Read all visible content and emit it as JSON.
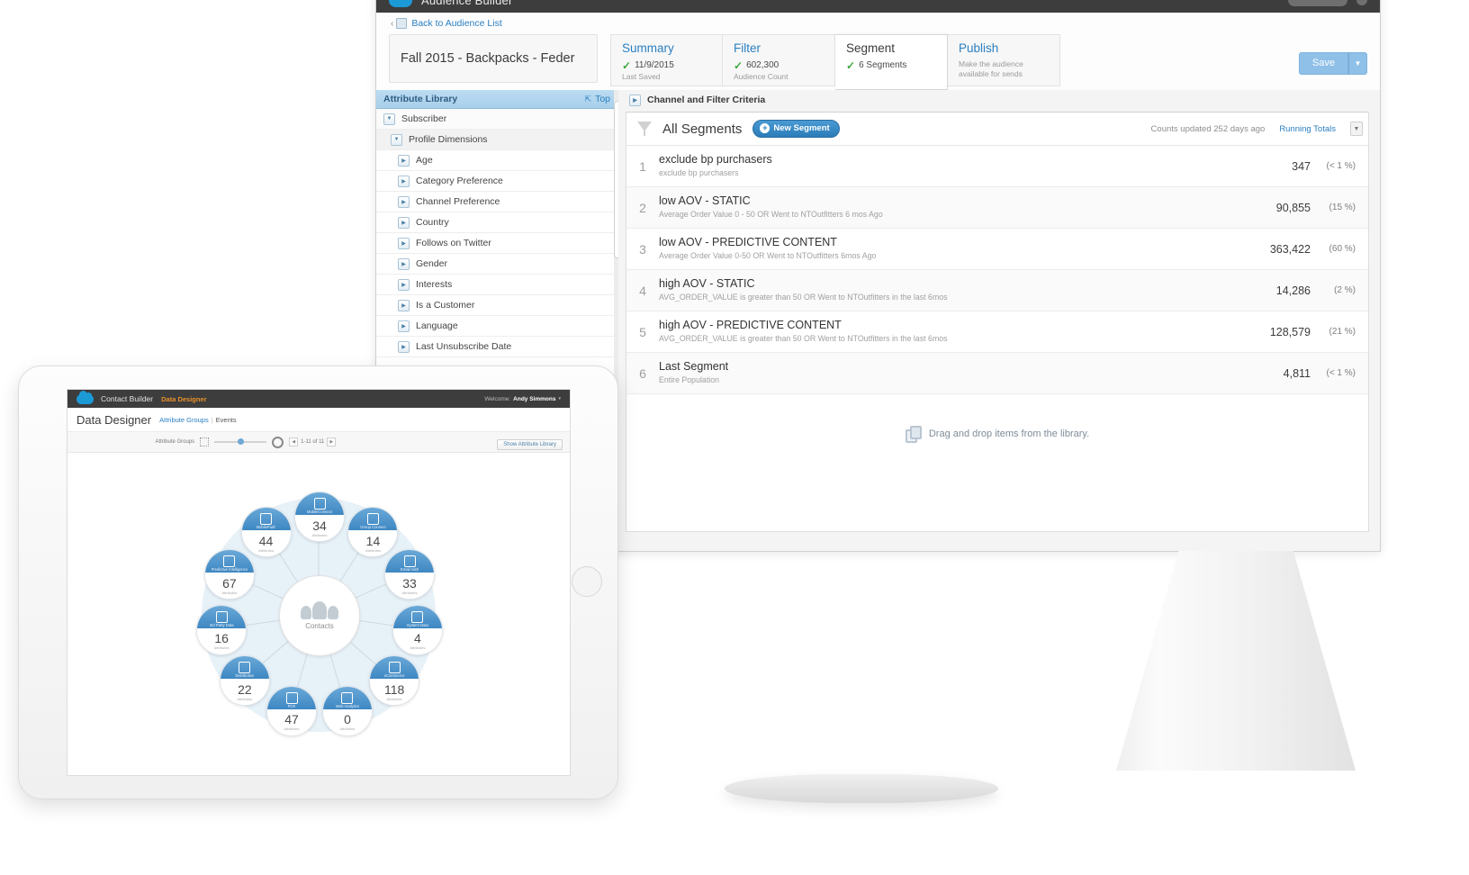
{
  "desktop": {
    "app_bar": {
      "title": "Audience Builder",
      "logo": "cloud-logo"
    },
    "back_link": {
      "label": "Back to Audience List",
      "caret": "‹"
    },
    "audience_name": "Fall 2015 - Backpacks - Feder",
    "tabs": [
      {
        "label": "Summary",
        "value": "11/9/2015",
        "sub": "Last Saved",
        "check": true,
        "active": false
      },
      {
        "label": "Filter",
        "value": "602,300",
        "sub": "Audience Count",
        "check": true,
        "active": false
      },
      {
        "label": "Segment",
        "value": "6 Segments",
        "sub": "",
        "check": true,
        "active": true
      },
      {
        "label": "Publish",
        "value": "",
        "sub": "",
        "desc": "Make the audience available for sends",
        "check": false,
        "active": false
      }
    ],
    "save": {
      "label": "Save",
      "caret": "▼"
    },
    "library": {
      "title": "Attribute Library",
      "top_label": "Top",
      "items": [
        {
          "label": "Subscriber",
          "level": 0,
          "state": "expanded"
        },
        {
          "label": "Profile Dimensions",
          "level": 1,
          "state": "expanded"
        },
        {
          "label": "Age",
          "level": 2,
          "state": "collapsed"
        },
        {
          "label": "Category Preference",
          "level": 2,
          "state": "collapsed"
        },
        {
          "label": "Channel Preference",
          "level": 2,
          "state": "collapsed"
        },
        {
          "label": "Country",
          "level": 2,
          "state": "collapsed"
        },
        {
          "label": "Follows on Twitter",
          "level": 2,
          "state": "collapsed"
        },
        {
          "label": "Gender",
          "level": 2,
          "state": "collapsed"
        },
        {
          "label": "Interests",
          "level": 2,
          "state": "collapsed"
        },
        {
          "label": "Is a Customer",
          "level": 2,
          "state": "collapsed"
        },
        {
          "label": "Language",
          "level": 2,
          "state": "collapsed"
        },
        {
          "label": "Last Unsubscribe Date",
          "level": 2,
          "state": "collapsed"
        }
      ]
    },
    "criteria_label": "Channel and Filter Criteria",
    "segments_panel": {
      "heading": "All Segments",
      "new_segment_label": "New Segment",
      "counts_note": "Counts updated 252 days ago",
      "running_totals_label": "Running Totals",
      "rows": [
        {
          "num": "1",
          "name": "exclude bp purchasers",
          "desc": "exclude bp purchasers",
          "count": "347",
          "pct": "(< 1 %)"
        },
        {
          "num": "2",
          "name": "low AOV - STATIC",
          "desc": "Average Order Value 0 - 50 OR  Went to NTOutfitters 6 mos Ago",
          "count": "90,855",
          "pct": "(15 %)"
        },
        {
          "num": "3",
          "name": "low AOV - PREDICTIVE CONTENT",
          "desc": "Average Order Value 0-50 OR  Went to NTOutfitters 6mos Ago",
          "count": "363,422",
          "pct": "(60 %)"
        },
        {
          "num": "4",
          "name": "high AOV - STATIC",
          "desc": "AVG_ORDER_VALUE is greater than  50 OR  Went to NTOutfitters in the last 6mos",
          "count": "14,286",
          "pct": "(2 %)"
        },
        {
          "num": "5",
          "name": "high AOV - PREDICTIVE CONTENT",
          "desc": "AVG_ORDER_VALUE is greater than  50 OR  Went to NTOutfitters in the last 6mos",
          "count": "128,579",
          "pct": "(21 %)"
        },
        {
          "num": "6",
          "name": "Last Segment",
          "desc": "Entire Population",
          "count": "4,811",
          "pct": "(< 1 %)"
        }
      ],
      "drop_hint": "Drag and drop items from the library."
    }
  },
  "tablet": {
    "app_bar": {
      "title": "Contact Builder",
      "sub": "Data Designer",
      "welcome_label": "Welcome:",
      "user": "Andy Simmons",
      "caret": "▾"
    },
    "page_title": "Data Designer",
    "subnav": {
      "first": "Attribute Groups",
      "sep": "|",
      "second": "Events"
    },
    "toolbar": {
      "label": "Attribute Groups",
      "pagination": "1-11 of 11",
      "show_library_label": "Show Attribute Library"
    },
    "diagram": {
      "hub_label": "Contacts",
      "attributes_word": "Attributes",
      "nodes": [
        {
          "title": "MobileConnect",
          "count": "34",
          "icon": "mobile-icon"
        },
        {
          "title": "Group Connect",
          "count": "14",
          "icon": "mobile-icon"
        },
        {
          "title": "Email Addr",
          "count": "33",
          "icon": "email-icon"
        },
        {
          "title": "System Data",
          "count": "4",
          "icon": "chart-icon"
        },
        {
          "title": "eCommerce",
          "count": "118",
          "icon": "dollar-icon"
        },
        {
          "title": "Web Analytics",
          "count": "0",
          "icon": "page-icon"
        },
        {
          "title": "POS",
          "count": "47",
          "icon": "register-icon"
        },
        {
          "title": "Distribution",
          "count": "22",
          "icon": "truck-icon"
        },
        {
          "title": "3rd Party Data",
          "count": "16",
          "icon": "laptop-icon"
        },
        {
          "title": "Predictive Intelligence",
          "count": "67",
          "icon": "cart-icon"
        },
        {
          "title": "MobilePush",
          "count": "44",
          "icon": "mobile-icon"
        }
      ]
    }
  }
}
